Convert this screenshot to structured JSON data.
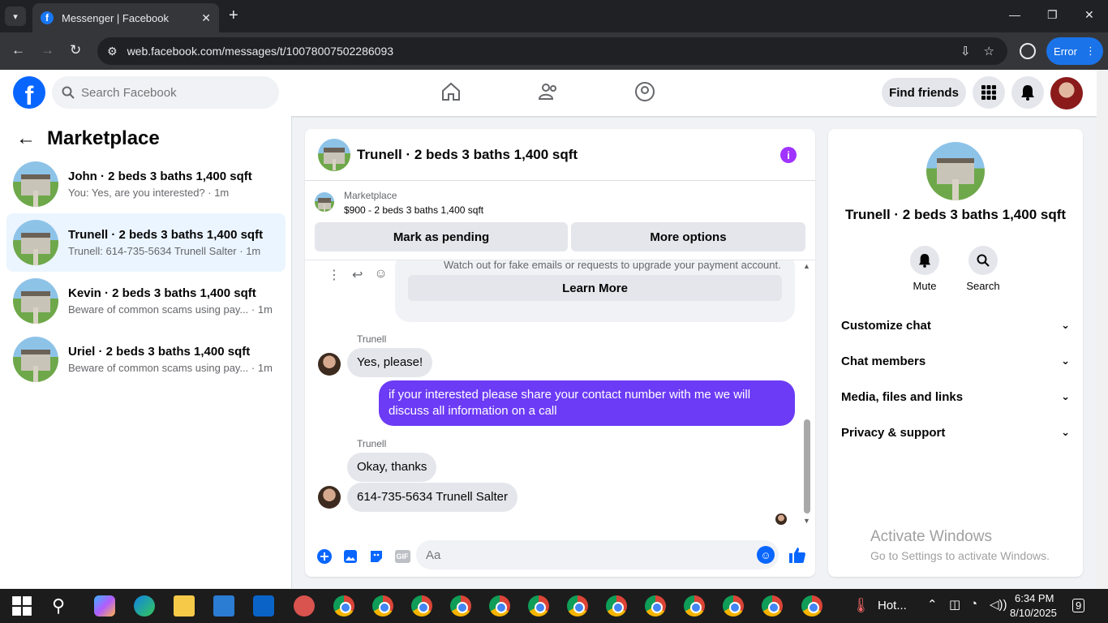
{
  "browser": {
    "tab_title": "Messenger | Facebook",
    "url": "web.facebook.com/messages/t/10078007502286093",
    "error_label": "Error"
  },
  "header": {
    "search_placeholder": "Search Facebook",
    "find_friends": "Find friends"
  },
  "left": {
    "title": "Marketplace",
    "conversations": [
      {
        "name": "John · 2 beds 3 baths 1,400 sqft",
        "preview": "You: Yes, are you interested? · 1m"
      },
      {
        "name": "Trunell · 2 beds 3 baths 1,400 sqft",
        "preview": "Trunell: 614-735-5634 Trunell Salter · 1m"
      },
      {
        "name": "Kevin · 2 beds 3 baths 1,400 sqft",
        "preview": "Beware of common scams using pay... · 1m"
      },
      {
        "name": "Uriel · 2 beds 3 baths 1,400 sqft",
        "preview": "Beware of common scams using pay... · 1m"
      }
    ]
  },
  "chat": {
    "title": "Trunell · 2 beds 3 baths 1,400 sqft",
    "marketplace_label": "Marketplace",
    "listing": "$900 - 2 beds 3 baths 1,400 sqft",
    "mark_pending": "Mark as pending",
    "more_options": "More options",
    "scam_text": "Watch out for fake emails or requests to upgrade your payment account.",
    "learn_more": "Learn More",
    "messages": [
      {
        "sender": "Trunell",
        "text": "Yes, please!"
      },
      {
        "sender": "me",
        "text": "if your interested please share your contact number with me we will discuss all information on a call"
      },
      {
        "sender": "Trunell",
        "text": "Okay, thanks"
      },
      {
        "sender": "Trunell",
        "text": "614-735-5634 Trunell Salter"
      }
    ],
    "composer_placeholder": "Aa",
    "gif_label": "GIF"
  },
  "right": {
    "name": "Trunell · 2 beds 3 baths 1,400 sqft",
    "mute": "Mute",
    "search": "Search",
    "rows": [
      "Customize chat",
      "Chat members",
      "Media, files and links",
      "Privacy & support"
    ],
    "activate_title": "Activate Windows",
    "activate_sub": "Go to Settings to activate Windows."
  },
  "taskbar": {
    "weather": "Hot...",
    "time": "6:34 PM",
    "date": "8/10/2025",
    "notif_count": "9"
  }
}
